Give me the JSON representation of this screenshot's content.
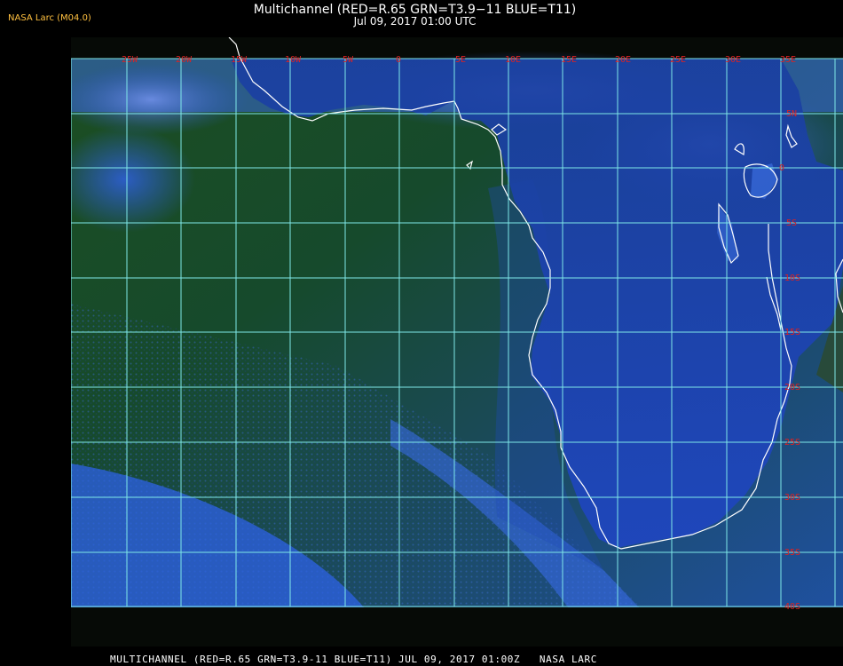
{
  "header": {
    "version_label": "NASA Larc (M04.0)",
    "title": "Multichannel (RED=R.65 GRN=T3.9−11 BLUE=T11)",
    "subtitle": "Jul 09, 2017 01:00 UTC"
  },
  "map": {
    "longitude_labels": [
      "25W",
      "20W",
      "15W",
      "10W",
      "5W",
      "0",
      "5E",
      "10E",
      "15E",
      "20E",
      "25E",
      "30E",
      "35E"
    ],
    "latitude_labels": [
      "5N",
      "0",
      "5S",
      "10S",
      "15S",
      "20S",
      "25S",
      "30S",
      "35S",
      "40S"
    ],
    "grid_color": "#7fe8e8",
    "label_color": "#dd2222",
    "coastline_color": "#ffffff"
  },
  "footer": {
    "caption": "MULTICHANNEL (RED=R.65 GRN=T3.9-11 BLUE=T11) JUL 09, 2017 01:00Z   NASA LARC"
  }
}
